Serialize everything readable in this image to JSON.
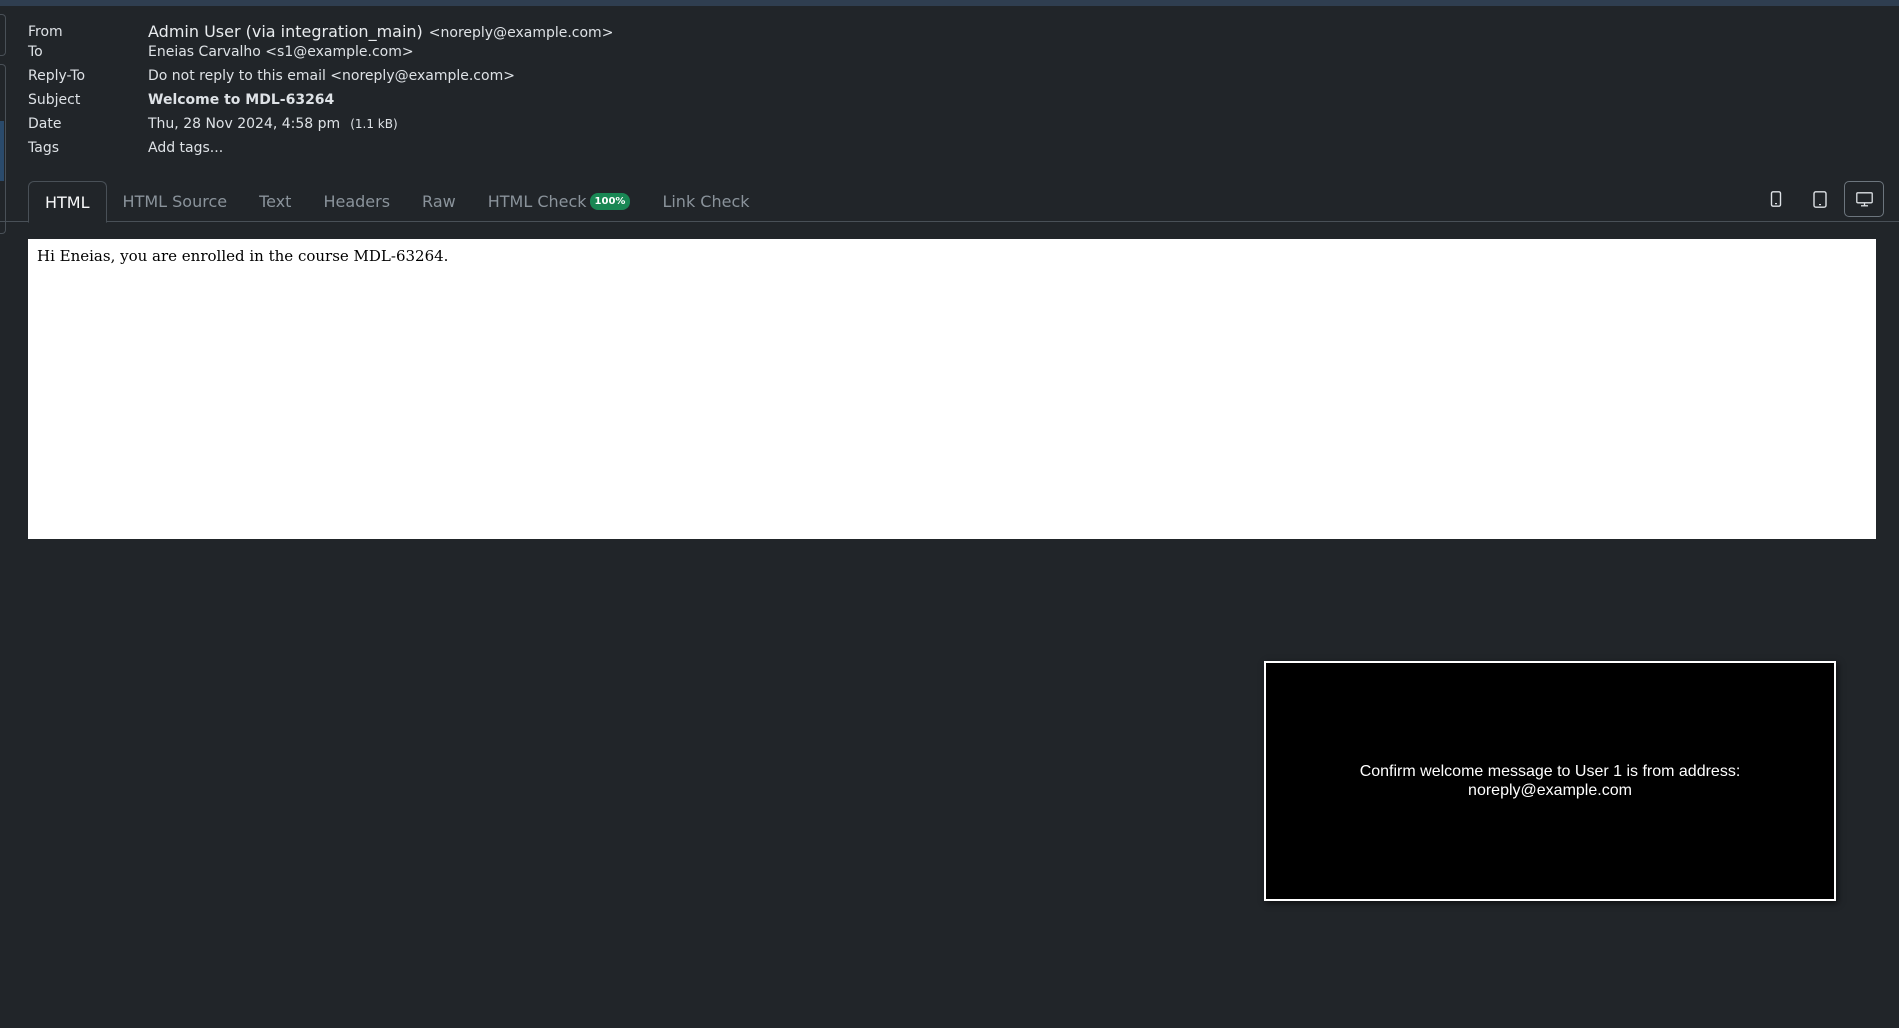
{
  "headers": {
    "from": {
      "label": "From",
      "name": "Admin User (via integration_main)",
      "address": "<noreply@example.com>"
    },
    "to": {
      "label": "To",
      "value": "Eneias Carvalho <s1@example.com>"
    },
    "reply_to": {
      "label": "Reply-To",
      "value": "Do not reply to this email <noreply@example.com>"
    },
    "subject": {
      "label": "Subject",
      "value": "Welcome to MDL-63264"
    },
    "date": {
      "label": "Date",
      "value": "Thu, 28 Nov 2024, 4:58 pm",
      "size": "(1.1 kB)"
    },
    "tags": {
      "label": "Tags",
      "placeholder": "Add tags..."
    }
  },
  "tabs": [
    {
      "label": "HTML",
      "active": true
    },
    {
      "label": "HTML Source",
      "active": false
    },
    {
      "label": "Text",
      "active": false
    },
    {
      "label": "Headers",
      "active": false
    },
    {
      "label": "Raw",
      "active": false
    },
    {
      "label": "HTML Check",
      "badge": "100%",
      "active": false
    },
    {
      "label": "Link Check",
      "active": false
    }
  ],
  "view_buttons": [
    {
      "icon": "phone-icon",
      "active": false
    },
    {
      "icon": "tablet-icon",
      "active": false
    },
    {
      "icon": "desktop-icon",
      "active": true
    }
  ],
  "preview": {
    "body_text": "Hi Eneias, you are enrolled in the course MDL-63264."
  },
  "overlay": {
    "message": "Confirm welcome message to User 1 is from address:\nnoreply@example.com"
  },
  "colors": {
    "background": "#212529",
    "badge_success": "#198754",
    "preview_bg": "#ffffff",
    "overlay_bg": "#000000"
  }
}
